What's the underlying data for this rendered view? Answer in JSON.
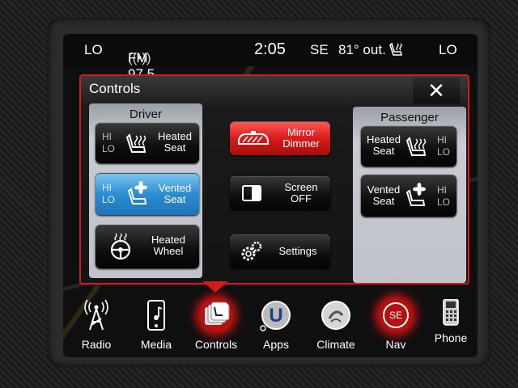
{
  "status": {
    "left_temp": "LO",
    "radio": "FM 97.5",
    "time": "2:05",
    "compass": "SE",
    "outside_temp": "81° out.",
    "right_temp": "LO"
  },
  "popup": {
    "title": "Controls",
    "close": "✕",
    "driver": {
      "title": "Driver",
      "heated_seat": {
        "hi": "HI",
        "lo": "LO",
        "label1": "Heated",
        "label2": "Seat"
      },
      "vented_seat": {
        "hi": "HI",
        "lo": "LO",
        "label1": "Vented",
        "label2": "Seat"
      },
      "heated_wheel": {
        "label1": "Heated",
        "label2": "Wheel"
      }
    },
    "center": {
      "mirror": {
        "label1": "Mirror",
        "label2": "Dimmer"
      },
      "screen": {
        "label1": "Screen",
        "label2": "OFF"
      },
      "settings": {
        "label": "Settings"
      }
    },
    "passenger": {
      "title": "Passenger",
      "heated_seat": {
        "hi": "HI",
        "lo": "LO",
        "label1": "Heated",
        "label2": "Seat"
      },
      "vented_seat": {
        "hi": "HI",
        "lo": "LO",
        "label1": "Vented",
        "label2": "Seat"
      }
    }
  },
  "nav": {
    "items": [
      {
        "label": "Radio",
        "icon": "radio-tower-icon"
      },
      {
        "label": "Media",
        "icon": "media-player-icon"
      },
      {
        "label": "Controls",
        "icon": "controls-icon",
        "active": true
      },
      {
        "label": "Apps",
        "icon": "apps-icon"
      },
      {
        "label": "Climate",
        "icon": "climate-icon"
      },
      {
        "label": "Nav",
        "icon": "compass-icon",
        "badge": "SE"
      },
      {
        "label": "Phone",
        "icon": "phone-icon"
      }
    ]
  },
  "colors": {
    "accent_red": "#d01c1c",
    "vent_blue": "#2a8ed3"
  }
}
